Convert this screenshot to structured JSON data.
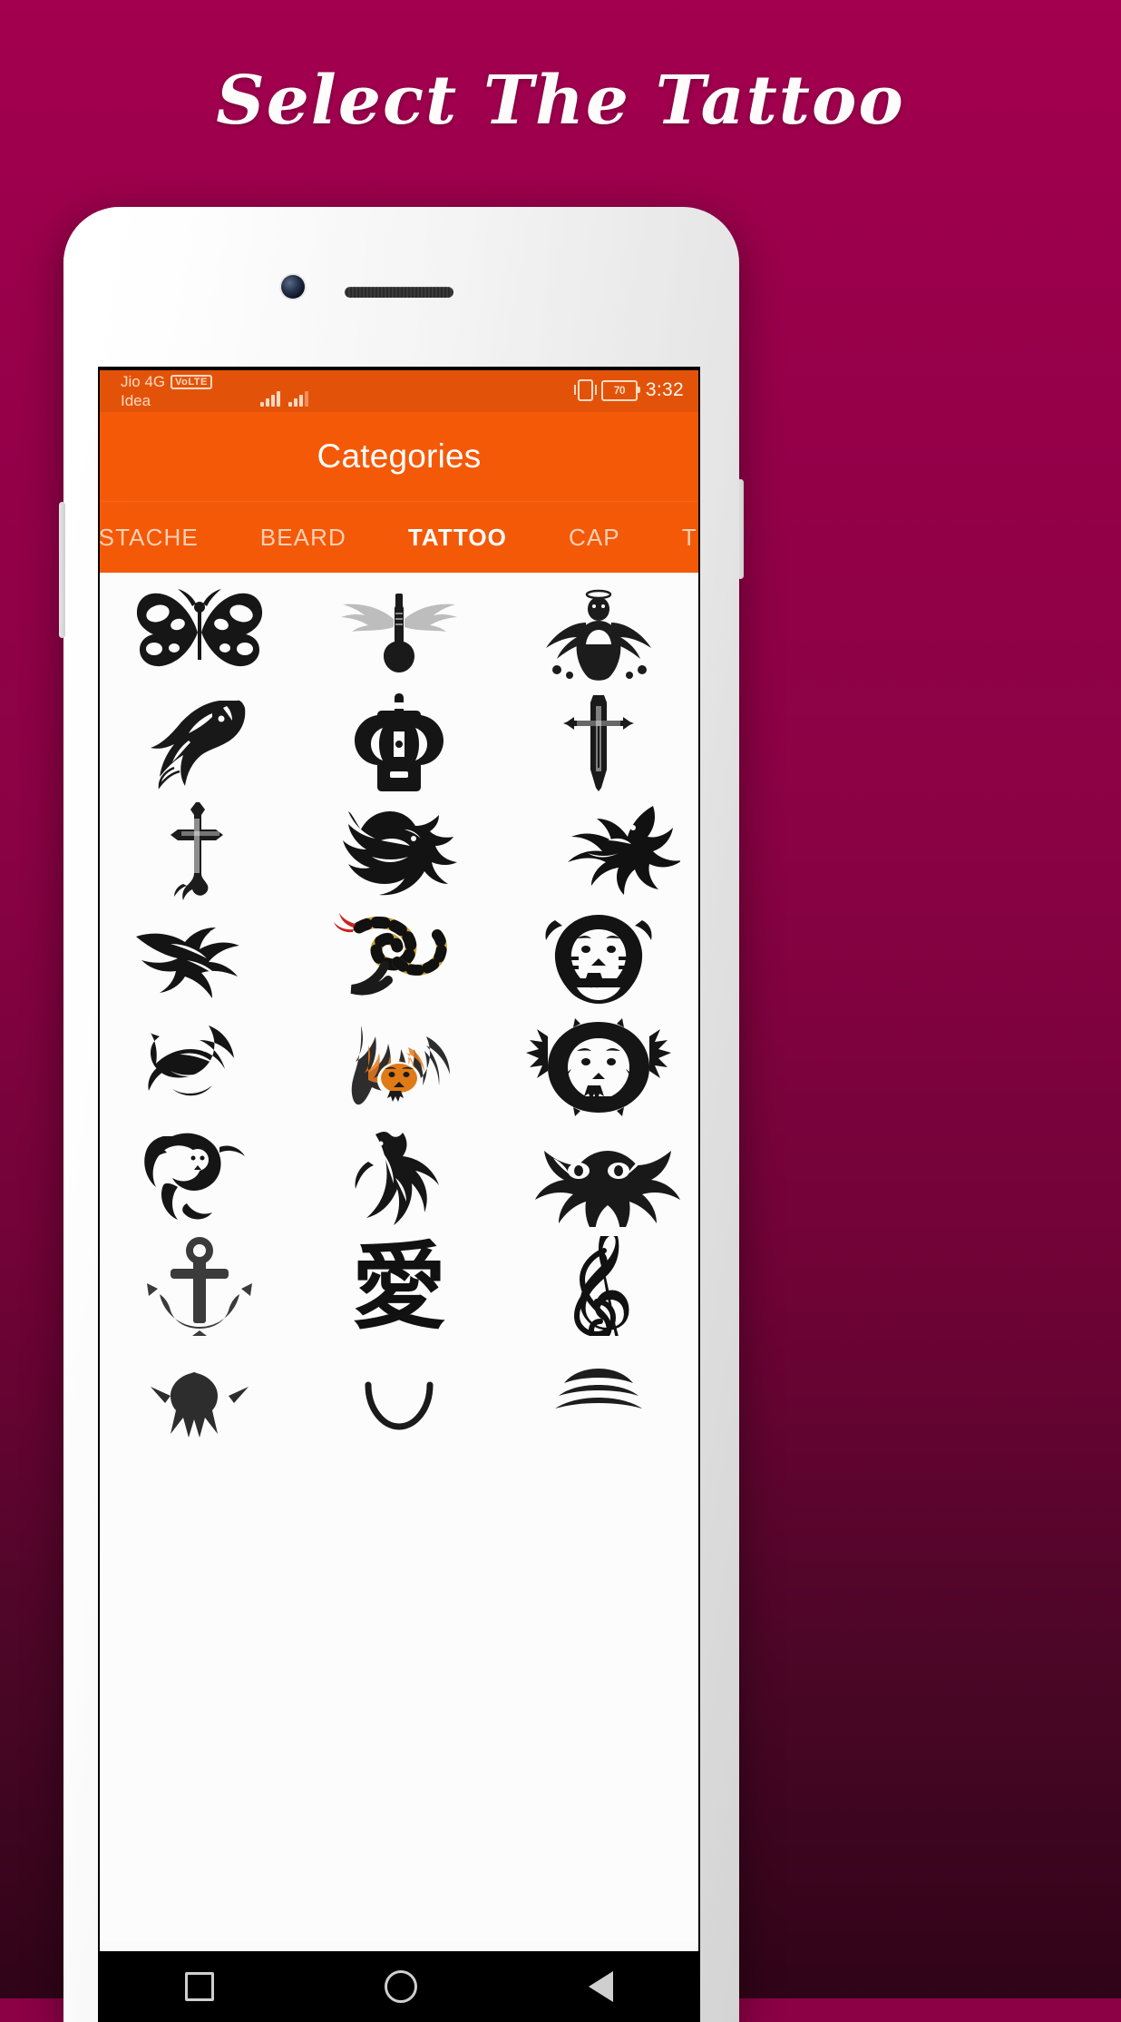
{
  "promo": {
    "title": "Select The Tattoo",
    "background_top_color": "#a3004f",
    "background_bottom_color": "#300418"
  },
  "phone": {
    "camera_icon": "front-camera-icon",
    "speaker_icon": "earpiece-speaker-icon"
  },
  "status_bar": {
    "carrier_primary": "Jio 4G",
    "volte_badge": "VoLTE",
    "carrier_secondary": "Idea",
    "signal_1_icon": "signal-bars-icon",
    "signal_2_icon": "signal-bars-icon",
    "vibrate_icon": "vibrate-icon",
    "battery_icon": "battery-icon",
    "battery_percent": "70",
    "time": "3:32",
    "background_color": "#e25309",
    "text_color": "#ffd9c2"
  },
  "app_bar": {
    "title": "Categories",
    "background_color": "#f45908",
    "title_color": "#ffffff"
  },
  "tabs": {
    "active_index": 2,
    "items": [
      {
        "label": "MUSTACHE"
      },
      {
        "label": "BEARD"
      },
      {
        "label": "TATTOO"
      },
      {
        "label": "CAP"
      },
      {
        "label": "TURBAN"
      }
    ]
  },
  "grid": {
    "columns": 3,
    "items": [
      {
        "name": "butterfly-tattoo"
      },
      {
        "name": "winged-guitar-tattoo"
      },
      {
        "name": "winged-angel-tattoo"
      },
      {
        "name": "horse-tattoo"
      },
      {
        "name": "celtic-cross-tattoo"
      },
      {
        "name": "crucifix-cross-tattoo"
      },
      {
        "name": "ornate-cross-tattoo"
      },
      {
        "name": "tribal-dragon-tattoo"
      },
      {
        "name": "tribal-dragon-alt-tattoo"
      },
      {
        "name": "tribal-eagle-tattoo"
      },
      {
        "name": "snake-tattoo"
      },
      {
        "name": "tiger-face-tattoo"
      },
      {
        "name": "tribal-wolf-tattoo"
      },
      {
        "name": "flaming-tiger-tattoo"
      },
      {
        "name": "lion-head-tattoo"
      },
      {
        "name": "ornate-lion-tattoo"
      },
      {
        "name": "howling-wolf-tattoo"
      },
      {
        "name": "ornamental-cat-tattoo"
      },
      {
        "name": "anchor-tattoo"
      },
      {
        "name": "kanji-love-tattoo"
      },
      {
        "name": "treble-clef-tattoo"
      },
      {
        "name": "partial-row-left"
      },
      {
        "name": "partial-row-center"
      },
      {
        "name": "partial-row-right"
      }
    ]
  },
  "nav_bar": {
    "recents_icon": "square-recents-icon",
    "home_icon": "circle-home-icon",
    "back_icon": "triangle-back-icon",
    "background_color": "#000000"
  }
}
